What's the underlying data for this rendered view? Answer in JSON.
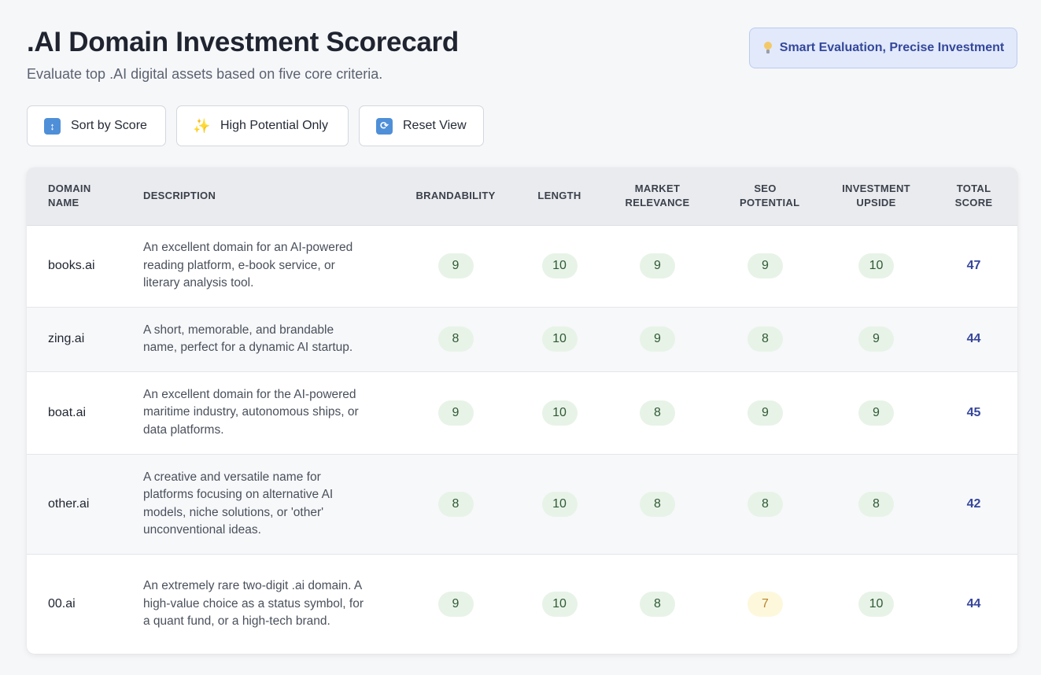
{
  "header": {
    "title": ".AI Domain Investment Scorecard",
    "subtitle": "Evaluate top .AI digital assets based on five core criteria.",
    "tagline": "Smart Evaluation, Precise Investment",
    "tagline_icon": "lightbulb-icon"
  },
  "toolbar": {
    "sort_label": "Sort by Score",
    "sort_icon": "sort-arrows-icon",
    "high_potential_label": "High Potential Only",
    "high_potential_icon": "sparkles-icon",
    "reset_label": "Reset View",
    "reset_icon": "refresh-icon"
  },
  "table": {
    "columns": [
      "Domain Name",
      "Description",
      "Brandability",
      "Length",
      "Market Relevance",
      "SEO Potential",
      "Investment Upside",
      "Total Score"
    ],
    "rows": [
      {
        "domain": "books.ai",
        "description": "An excellent domain for an AI-powered reading platform, e-book service, or literary analysis tool.",
        "scores": [
          9,
          10,
          9,
          9,
          10
        ],
        "total": 47
      },
      {
        "domain": "zing.ai",
        "description": "A short, memorable, and brandable name, perfect for a dynamic AI startup.",
        "scores": [
          8,
          10,
          9,
          8,
          9
        ],
        "total": 44
      },
      {
        "domain": "boat.ai",
        "description": "An excellent domain for the AI-powered maritime industry, autonomous ships, or data platforms.",
        "scores": [
          9,
          10,
          8,
          9,
          9
        ],
        "total": 45
      },
      {
        "domain": "other.ai",
        "description": "A creative and versatile name for platforms focusing on alternative AI models, niche solutions, or 'other' unconventional ideas.",
        "scores": [
          8,
          10,
          8,
          8,
          8
        ],
        "total": 42
      },
      {
        "domain": "00.ai",
        "description": "An extremely rare two-digit .ai domain. A high-value choice as a status symbol, for a quant fund, or a high-tech brand.",
        "scores": [
          9,
          10,
          8,
          7,
          10
        ],
        "total": 44
      }
    ]
  },
  "colors": {
    "score_good_bg": "#e8f3e8",
    "score_warn_bg": "#fdf8dc",
    "total_text": "#36469c",
    "tagline_bg": "#e1e9fb"
  }
}
